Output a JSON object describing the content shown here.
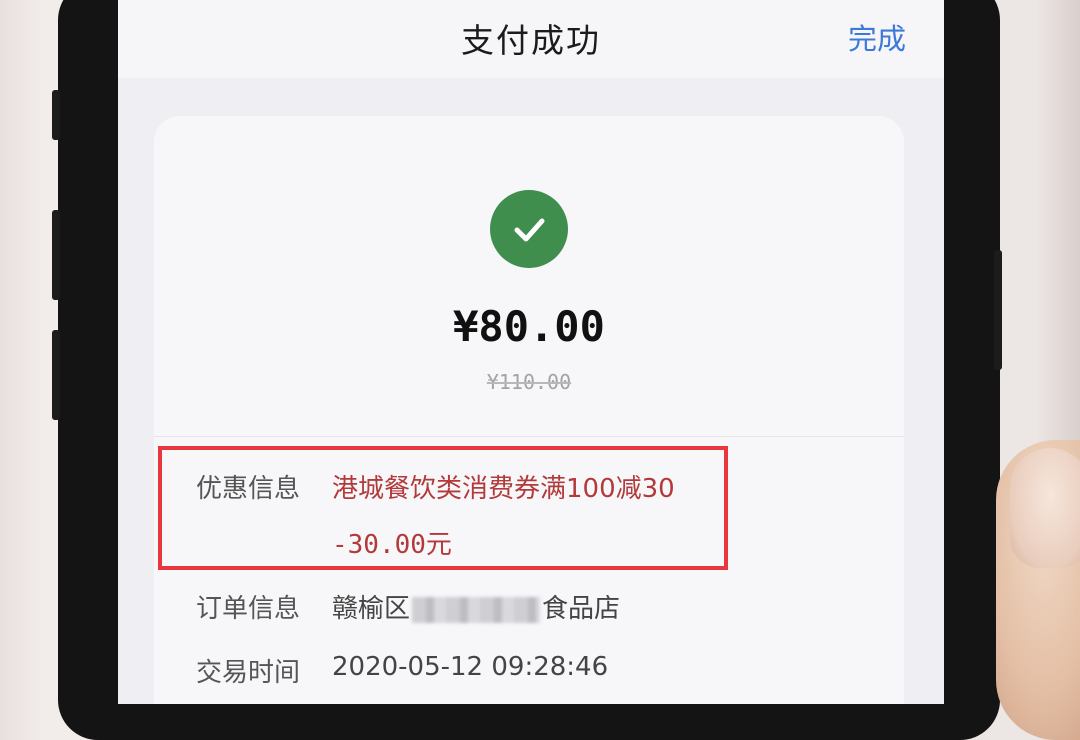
{
  "header": {
    "title": "支付成功",
    "done_label": "完成"
  },
  "payment": {
    "amount": "¥80.00",
    "original_amount": "¥110.00",
    "status_icon": "check-icon",
    "success_color": "#3f8e4e"
  },
  "details": {
    "discount": {
      "label": "优惠信息",
      "coupon_name": "港城餐饮类消费券满100减30",
      "discount_amount": "-30.00元",
      "color": "#b33a3a"
    },
    "order": {
      "label": "订单信息",
      "merchant_prefix": "赣榆区",
      "merchant_suffix": "食品店"
    },
    "time": {
      "label": "交易时间",
      "value": "2020-05-12 09:28:46"
    }
  },
  "annotation": {
    "highlight_color": "#e8373d"
  },
  "theme": {
    "accent": "#3d7ad8"
  }
}
